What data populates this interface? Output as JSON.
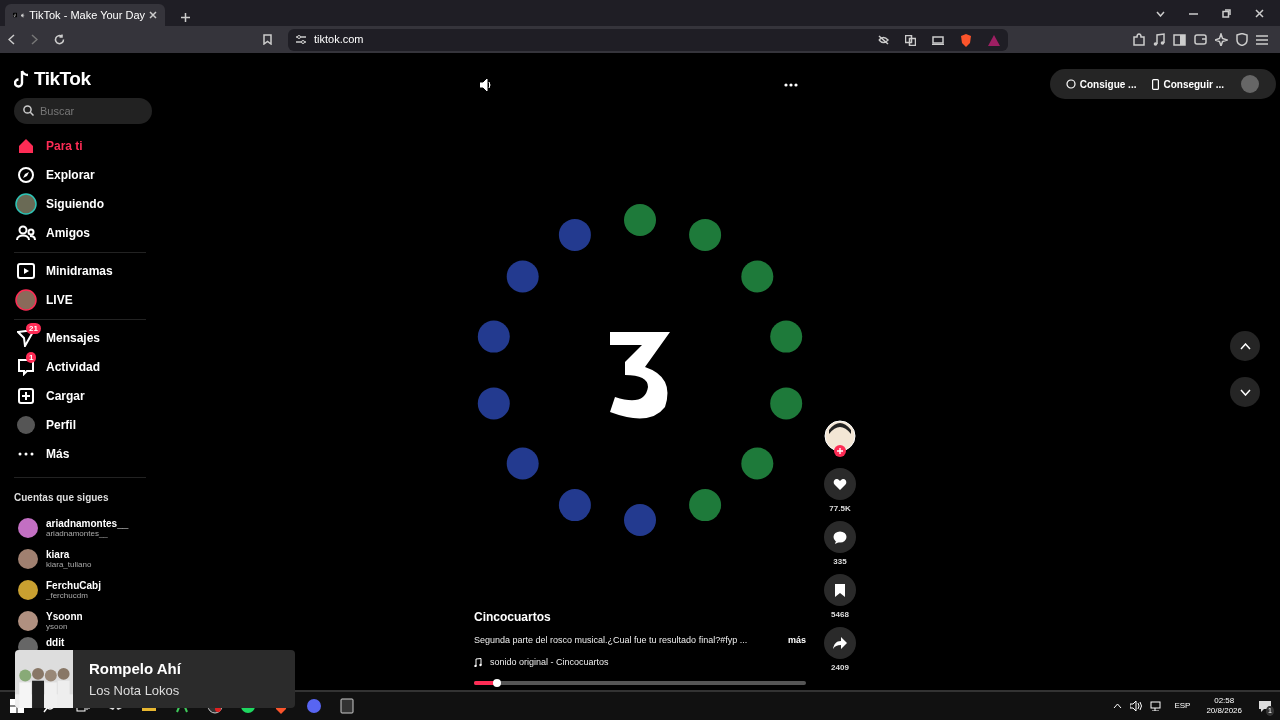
{
  "browser": {
    "tab": {
      "title": "TikTok - Make Your Day"
    },
    "url": "tiktok.com"
  },
  "sidebar": {
    "logo": "TikTok",
    "search": {
      "placeholder": "Buscar"
    },
    "nav_groups": [
      [
        {
          "label": "Para ti",
          "selected": true
        },
        {
          "label": "Explorar",
          "selected": false
        },
        {
          "label": "Siguiendo",
          "selected": false
        },
        {
          "label": "Amigos",
          "selected": false
        }
      ],
      [
        {
          "label": "Minidramas",
          "selected": false
        },
        {
          "label": "LIVE",
          "selected": false
        }
      ],
      [
        {
          "label": "Mensajes",
          "selected": false,
          "badge": "21"
        },
        {
          "label": "Actividad",
          "selected": false,
          "badge": "1"
        },
        {
          "label": "Cargar",
          "selected": false
        },
        {
          "label": "Perfil",
          "selected": false
        },
        {
          "label": "Más",
          "selected": false
        }
      ]
    ],
    "following_title": "Cuentas que sigues",
    "accounts": [
      {
        "name": "ariadnamontes__",
        "handle": "ariadnamontes__"
      },
      {
        "name": "kiara",
        "handle": "kiara_tuliano"
      },
      {
        "name": "FerchuCabj",
        "handle": "_ferchucdm"
      },
      {
        "name": "Ysoonn",
        "handle": "ysoon"
      },
      {
        "name": "ddit"
      }
    ]
  },
  "top_actions": [
    {
      "label": "Consigue ..."
    },
    {
      "label": "Conseguir ..."
    }
  ],
  "video": {
    "kind": "picture",
    "author": "Cincocuartos",
    "description": "Segunda parte del rosco musical.¿Cual fue tu resultado final?#fyp ...",
    "more": "más",
    "sound": "sonido original - Cincocuartos"
  },
  "actions": [
    {
      "count": "77.5K"
    },
    {
      "count": "335"
    },
    {
      "count": "5468"
    },
    {
      "count": "2409"
    }
  ],
  "media_popup": {
    "title": "Rompelo Ahí",
    "artist": "Los Nota Lokos"
  },
  "taskbar": {
    "language": "ESP",
    "time": "02:58",
    "date": "20/8/2026",
    "notifications": "1"
  }
}
